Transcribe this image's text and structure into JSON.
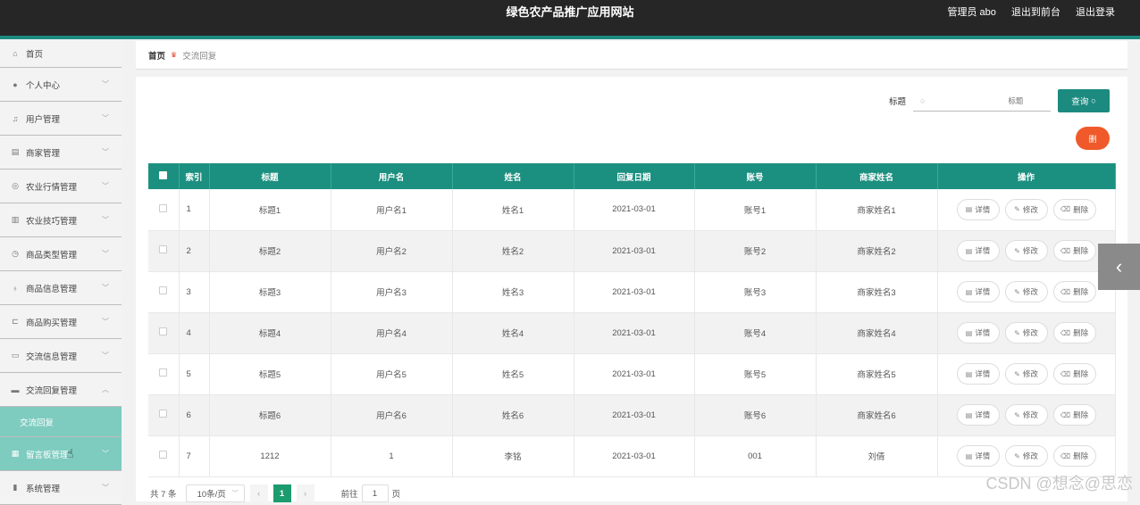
{
  "header": {
    "title": "绿色农产品推广应用网站",
    "admin": "管理员 abo",
    "front": "退出到前台",
    "logout": "退出登录"
  },
  "sidebar": {
    "items": [
      {
        "label": "首页",
        "icon": "home-icon"
      },
      {
        "label": "个人中心",
        "icon": "user-icon"
      },
      {
        "label": "用户管理",
        "icon": "bell-icon"
      },
      {
        "label": "商家管理",
        "icon": "shop-icon"
      },
      {
        "label": "农业行情管理",
        "icon": "compass-icon"
      },
      {
        "label": "农业技巧管理",
        "icon": "chart-icon"
      },
      {
        "label": "商品类型管理",
        "icon": "clock-icon"
      },
      {
        "label": "商品信息管理",
        "icon": "mic-icon"
      },
      {
        "label": "商品购买管理",
        "icon": "crop-icon"
      },
      {
        "label": "交流信息管理",
        "icon": "message-icon"
      },
      {
        "label": "交流回复管理",
        "icon": "monitor-icon"
      },
      {
        "label": "交流回复",
        "icon": ""
      },
      {
        "label": "留言板管理",
        "icon": "board-icon"
      },
      {
        "label": "系统管理",
        "icon": "bars-icon"
      }
    ]
  },
  "breadcrumb": {
    "home": "首页",
    "current": "交流回复"
  },
  "search": {
    "label": "标题",
    "placeholder": "标题",
    "button": "查询"
  },
  "delete_button": "删",
  "table": {
    "headers": [
      "索引",
      "标题",
      "用户名",
      "姓名",
      "回复日期",
      "账号",
      "商家姓名",
      "操作"
    ],
    "rows": [
      [
        "1",
        "标题1",
        "用户名1",
        "姓名1",
        "2021-03-01",
        "账号1",
        "商家姓名1"
      ],
      [
        "2",
        "标题2",
        "用户名2",
        "姓名2",
        "2021-03-01",
        "账号2",
        "商家姓名2"
      ],
      [
        "3",
        "标题3",
        "用户名3",
        "姓名3",
        "2021-03-01",
        "账号3",
        "商家姓名3"
      ],
      [
        "4",
        "标题4",
        "用户名4",
        "姓名4",
        "2021-03-01",
        "账号4",
        "商家姓名4"
      ],
      [
        "5",
        "标题5",
        "用户名5",
        "姓名5",
        "2021-03-01",
        "账号5",
        "商家姓名5"
      ],
      [
        "6",
        "标题6",
        "用户名6",
        "姓名6",
        "2021-03-01",
        "账号6",
        "商家姓名6"
      ],
      [
        "7",
        "1212",
        "1",
        "李铭",
        "2021-03-01",
        "001",
        "刘倩"
      ]
    ],
    "actions": {
      "detail": "详情",
      "edit": "修改",
      "delete": "删除"
    }
  },
  "pager": {
    "total": "共 7 条",
    "size": "10条/页",
    "page": "1",
    "goto_prefix": "前往",
    "goto_value": "1",
    "goto_suffix": "页"
  },
  "watermark": "CSDN @想念@思恋",
  "colors": {
    "header": "#262626",
    "accent": "#1c8a7f",
    "table_header": "#1c9080",
    "sidebar_highlight": "#7ecbbf",
    "delete": "#f05a2a"
  }
}
